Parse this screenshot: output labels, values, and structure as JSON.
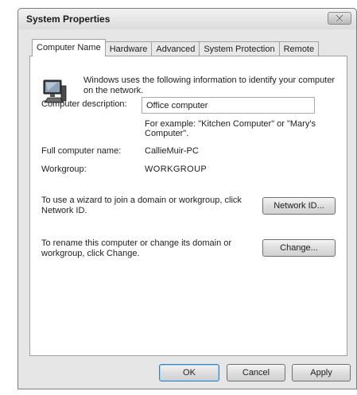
{
  "window": {
    "title": "System Properties"
  },
  "icons": {
    "close": "close-icon",
    "computer": "computer-icon"
  },
  "tabs": [
    {
      "label": "Computer Name",
      "active": true
    },
    {
      "label": "Hardware",
      "active": false
    },
    {
      "label": "Advanced",
      "active": false
    },
    {
      "label": "System Protection",
      "active": false
    },
    {
      "label": "Remote",
      "active": false
    }
  ],
  "panel": {
    "intro_line1": "Windows uses the following information to identify your computer",
    "intro_line2": "on the network.",
    "description_label": "Computer description:",
    "description_value": "Office computer",
    "example_line1": "For example: \"Kitchen Computer\" or \"Mary's",
    "example_line2": "Computer\".",
    "full_name_label": "Full computer name:",
    "full_name_value": "CallieMuir-PC",
    "workgroup_label": "Workgroup:",
    "workgroup_value": "WORKGROUP",
    "wizard_text_line1": "To use a wizard to join a domain or workgroup, click",
    "wizard_text_line2": "Network ID.",
    "network_id_button": "Network ID...",
    "rename_text_line1": "To rename this computer or change its domain or",
    "rename_text_line2": "workgroup, click Change.",
    "change_button": "Change..."
  },
  "footer": {
    "ok": "OK",
    "cancel": "Cancel",
    "apply": "Apply"
  }
}
